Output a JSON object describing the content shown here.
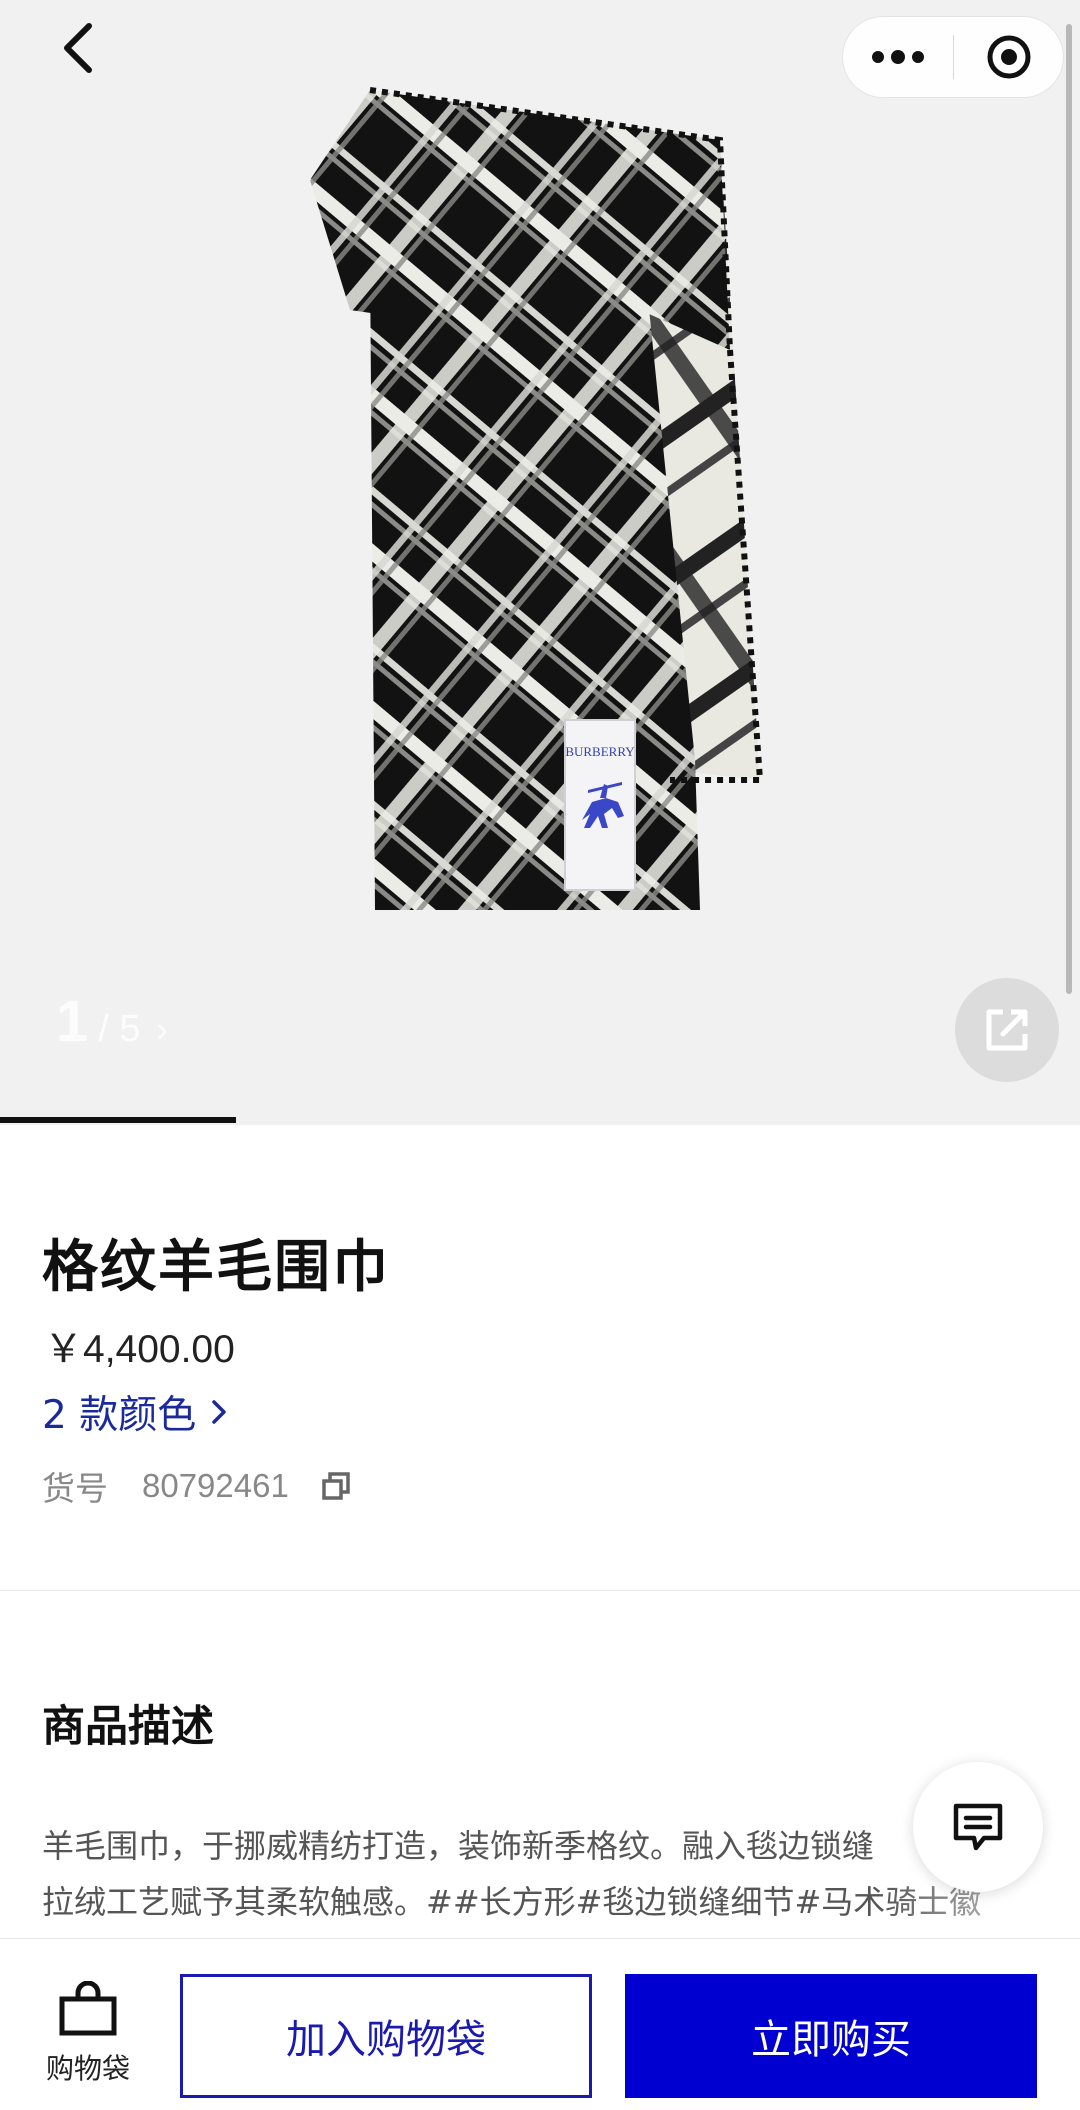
{
  "gallery": {
    "current_index": "1",
    "total": "/ 5",
    "next_arrow": "›",
    "label_text": "BURBERRY",
    "progress_fraction": 0.2
  },
  "product": {
    "title": "格纹羊毛围巾",
    "price": "￥4,400.00",
    "colors_label": "2 款颜色",
    "sku_label": "货号",
    "sku_value": "80792461"
  },
  "description": {
    "heading": "商品描述",
    "lines": [
      "羊毛围巾，于挪威精纺打造，装饰新季格纹。融入毯边锁缝",
      "拉绒工艺赋予其柔软触感。##长方形#毯边锁缝细节#马术骑士徽"
    ]
  },
  "bottom_bar": {
    "bag_label": "购物袋",
    "add_to_bag": "加入购物袋",
    "buy_now": "立即购买"
  },
  "colors": {
    "accent_blue": "#1a1ab0",
    "buy_button": "#0000d0",
    "color_link": "#1a2a9c"
  },
  "icons": [
    "back-arrow-icon",
    "more-dots-icon",
    "target-icon",
    "share-icon",
    "copy-icon",
    "chat-icon",
    "shopping-bag-icon",
    "chevron-right-icon"
  ]
}
